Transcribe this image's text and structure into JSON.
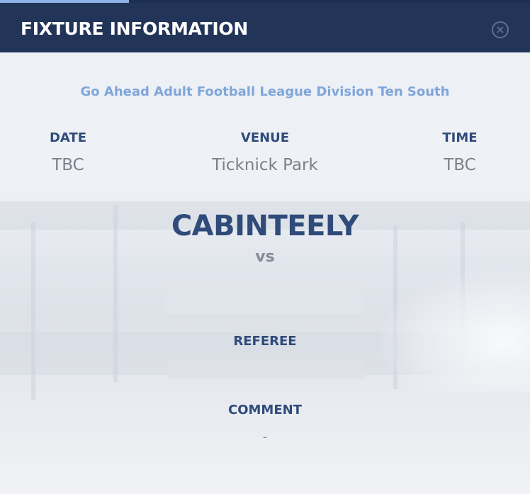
{
  "modal": {
    "title": "FIXTURE INFORMATION",
    "close_icon": "close-circle-icon"
  },
  "fixture": {
    "league": "Go Ahead Adult Football League Division Ten South",
    "date_label": "DATE",
    "date_value": "TBC",
    "venue_label": "VENUE",
    "venue_value": "Ticknick Park",
    "time_label": "TIME",
    "time_value": "TBC",
    "home_team": "CABINTEELY",
    "vs_label": "vs",
    "away_team": "",
    "referee_label": "REFEREE",
    "referee_value": "",
    "comment_label": "COMMENT",
    "comment_value": "-"
  },
  "colors": {
    "header_bg": "#223558",
    "accent_light_blue": "#7fa6db",
    "label_navy": "#2f4b7a",
    "value_grey": "#7b808a"
  }
}
